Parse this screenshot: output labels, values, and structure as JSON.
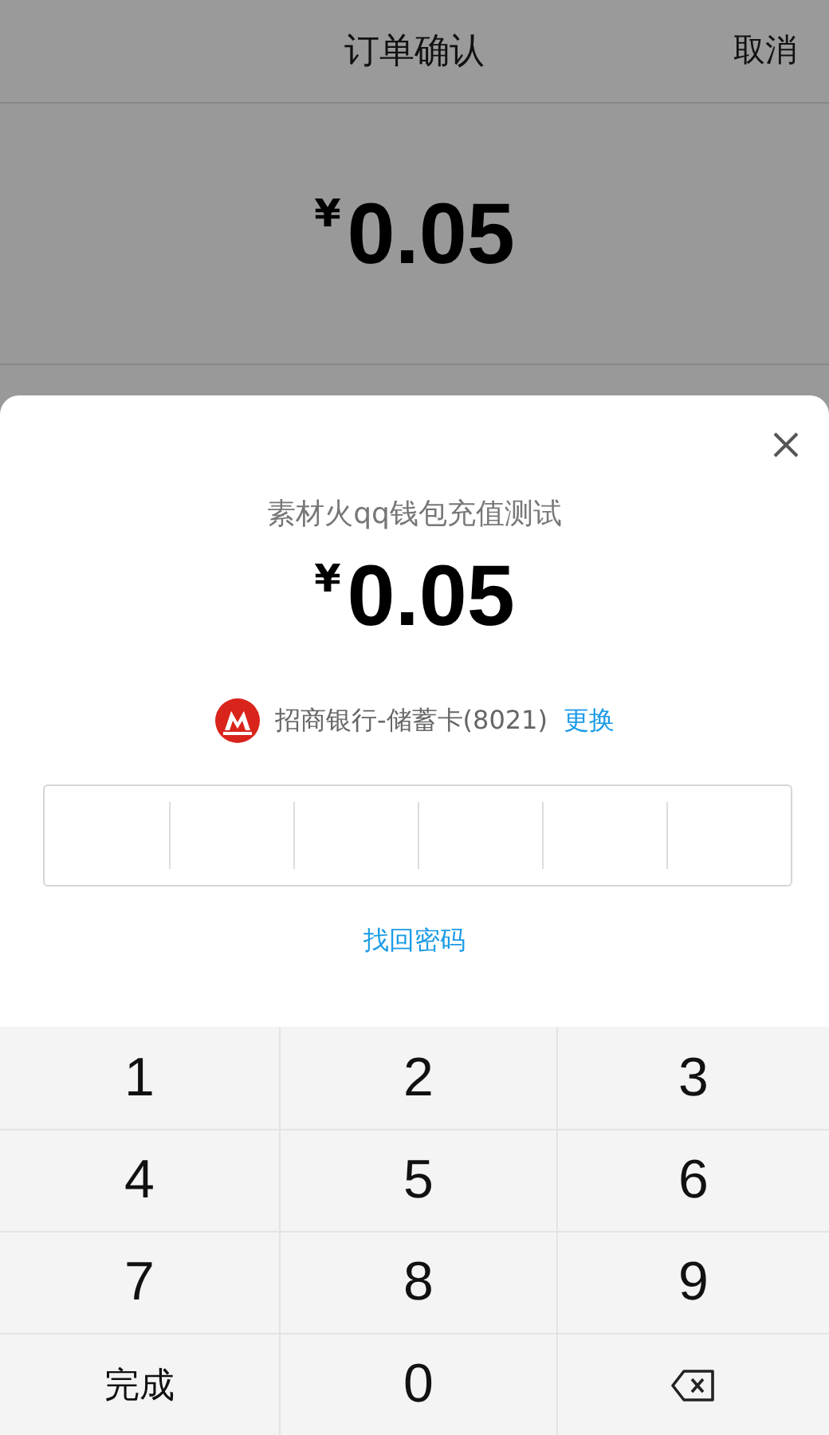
{
  "header": {
    "title": "订单确认",
    "cancel": "取消"
  },
  "order": {
    "currency": "¥",
    "amount": "0.05"
  },
  "sheet": {
    "title": "素材火qq钱包充值测试",
    "currency": "¥",
    "amount": "0.05",
    "card": "招商银行-储蓄卡(8021)",
    "change": "更换",
    "forgot": "找回密码"
  },
  "keypad": [
    {
      "kind": "digit",
      "label": "1"
    },
    {
      "kind": "digit",
      "label": "2"
    },
    {
      "kind": "digit",
      "label": "3"
    },
    {
      "kind": "digit",
      "label": "4"
    },
    {
      "kind": "digit",
      "label": "5"
    },
    {
      "kind": "digit",
      "label": "6"
    },
    {
      "kind": "digit",
      "label": "7"
    },
    {
      "kind": "digit",
      "label": "8"
    },
    {
      "kind": "digit",
      "label": "9"
    },
    {
      "kind": "text",
      "label": "完成"
    },
    {
      "kind": "digit",
      "label": "0"
    },
    {
      "kind": "backspace"
    }
  ]
}
